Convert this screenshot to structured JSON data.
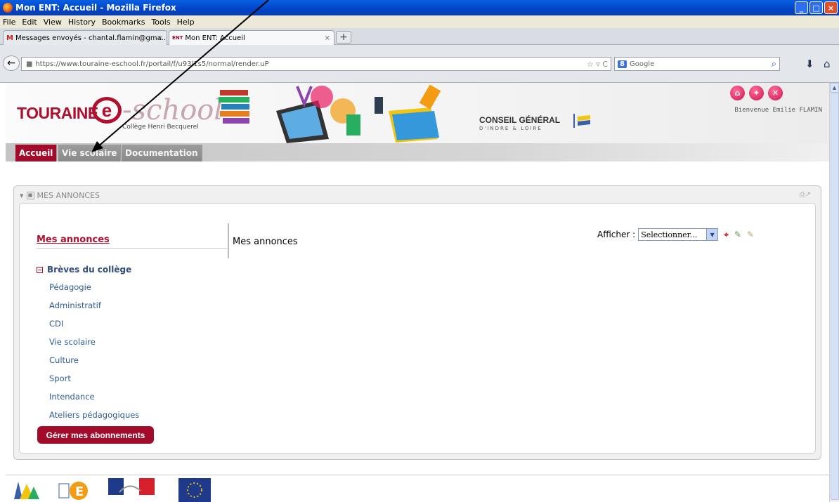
{
  "window": {
    "title": "Mon ENT: Accueil - Mozilla Firefox",
    "min_glyph": "_",
    "max_glyph": "□",
    "close_glyph": "×"
  },
  "menu": [
    "File",
    "Edit",
    "View",
    "History",
    "Bookmarks",
    "Tools",
    "Help"
  ],
  "tabs": [
    {
      "favicon": "M",
      "label": "Messages envoyés - chantal.flamin@gma...",
      "close": "×"
    },
    {
      "favicon": "ENT",
      "label": "Mon ENT: Accueil",
      "close": "×"
    }
  ],
  "newtab_glyph": "+",
  "nav": {
    "back_glyph": "←",
    "url": "https://www.touraine-eschool.fr/portail/f/u93l1s5/normal/render.uP",
    "star_glyph": "☆ ▿ C",
    "search_engine_badge": "8",
    "search_placeholder": "Google",
    "search_glyph": "⌕",
    "download_glyph": "⬇",
    "home_glyph": "⌂"
  },
  "header": {
    "logo_word": "TOURAINE",
    "logo_e": "e",
    "logo_school": "-school",
    "college": "Collège Henri Becquerel",
    "cg_title": "CONSEIL GÉNÉRAL",
    "cg_subtitle": "D'INDRE & LOIRE",
    "icon_home": "⌂",
    "icon_help": "✦",
    "icon_logout": "✕",
    "welcome": "Bienvenue  Emilie FLAMIN"
  },
  "portal_tabs": [
    "Accueil",
    "Vie scolaire",
    "Documentation"
  ],
  "box": {
    "title": "MES ANNONCES",
    "left_title": "Mes annonces",
    "main_title": "Mes annonces",
    "afficher_label": "Afficher :",
    "select_value": "Selectionner...",
    "category_header": "Brèves du collège",
    "category_glyph": "−",
    "categories": [
      "Pédagogie",
      "Administratif",
      "CDI",
      "Vie scolaire",
      "Culture",
      "Sport",
      "Intendance",
      "Ateliers pédagogiques"
    ],
    "button": "Gérer mes abonnements"
  },
  "colors": {
    "brand_red": "#a30b2b",
    "link_blue": "#2e5c94",
    "xp_blue": "#0044c8"
  }
}
